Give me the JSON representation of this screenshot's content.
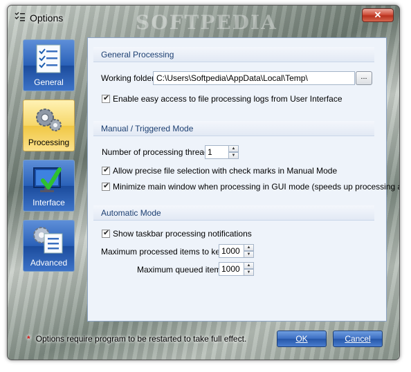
{
  "window": {
    "title": "Options",
    "watermark": "SOFTPEDIA",
    "close_label": "✕"
  },
  "nav": {
    "items": [
      {
        "label": "General",
        "icon": "checklist-icon"
      },
      {
        "label": "Processing",
        "icon": "gears-icon",
        "selected": true
      },
      {
        "label": "Interface",
        "icon": "monitor-checkmark-icon"
      },
      {
        "label": "Advanced",
        "icon": "gear-checklist-icon"
      }
    ]
  },
  "general": {
    "heading": "General Processing",
    "working_folder_label": "Working folder:",
    "working_folder_value": "C:\\Users\\Softpedia\\AppData\\Local\\Temp\\",
    "browse_label": "...",
    "easy_access_label": "Enable easy access to file processing logs from User Interface"
  },
  "manual": {
    "heading": "Manual / Triggered Mode",
    "threads_label": "Number of processing threads:",
    "threads_value": "1",
    "precise_selection_label": "Allow precise file selection with check marks in Manual Mode",
    "minimize_label": "Minimize main window when processing in GUI mode (speeds up processing a bit)"
  },
  "automatic": {
    "heading": "Automatic Mode",
    "taskbar_label": "Show taskbar processing notifications",
    "max_processed_label": "Maximum processed items to keep:",
    "max_processed_value": "1000",
    "max_queued_label": "Maximum queued items:",
    "max_queued_value": "1000"
  },
  "footer": {
    "star": "*",
    "note": "Options require program to be restarted to take full effect.",
    "ok_label": "OK",
    "cancel_label": "Cancel"
  },
  "colors": {
    "accent_blue": "#2a61b8",
    "selected_yellow": "#f6d76a",
    "panel_bg": "#eef3fa",
    "required_star": "#d11a1a"
  }
}
